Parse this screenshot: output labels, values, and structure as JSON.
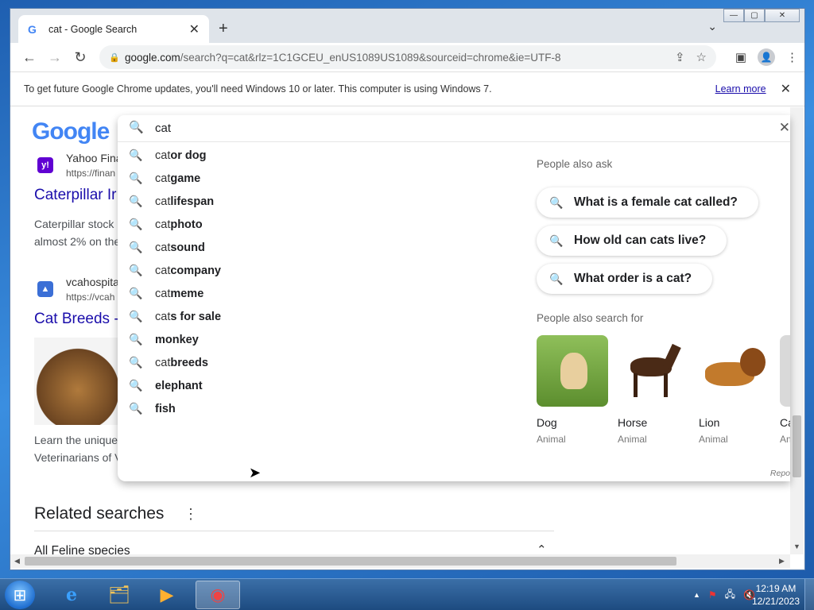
{
  "window": {
    "minimize": "—",
    "maximize": "▢",
    "close": "✕"
  },
  "tab": {
    "icon": "G",
    "title": "cat - Google Search",
    "close": "✕",
    "new_tab": "+",
    "tab_search": "⌄"
  },
  "toolbar": {
    "back": "←",
    "forward": "→",
    "reload": "↻",
    "lock": "🔒",
    "url_host": "google.com",
    "url_path": "/search?q=cat&rlz=1C1GCEU_enUS1089US1089&sourceid=chrome&ie=UTF-8",
    "share": "⇪",
    "bookmark": "☆",
    "side_panel": "▣",
    "profile": "👤",
    "menu": "⋮"
  },
  "infobar": {
    "message": "To get future Google Chrome updates, you'll need Windows 10 or later. This computer is using Windows 7.",
    "learn_more": "Learn more",
    "close": "✕"
  },
  "results": {
    "logo": "Google",
    "r1_source": "Yahoo Fina",
    "r1_url": "https://finan",
    "r1_title": "Caterpillar Ir",
    "r1_snip1": "Caterpillar stock",
    "r1_snip2": "almost 2% on the",
    "r2_source": "vcahospita",
    "r2_url": "https://vcah",
    "r2_title": "Cat Breeds -",
    "r2_snip1": "Learn the unique",
    "r2_snip2": "Veterinarians of V",
    "related_title": "Related searches",
    "related_menu": "⋮",
    "related_item": "All Feline species",
    "related_chevron": "⌃"
  },
  "search": {
    "query": "cat",
    "clear": "✕",
    "icon": "🔍",
    "suggestions": [
      {
        "plain": "cat ",
        "bold": "or dog"
      },
      {
        "plain": "cat ",
        "bold": "game"
      },
      {
        "plain": "cat ",
        "bold": "lifespan"
      },
      {
        "plain": "cat ",
        "bold": "photo"
      },
      {
        "plain": "cat ",
        "bold": "sound"
      },
      {
        "plain": "cat ",
        "bold": "company"
      },
      {
        "plain": "cat ",
        "bold": "meme"
      },
      {
        "plain": "cat",
        "bold": "s for sale"
      },
      {
        "plain": "",
        "bold": "monkey"
      },
      {
        "plain": "cat ",
        "bold": "breeds"
      },
      {
        "plain": "",
        "bold": "elephant"
      },
      {
        "plain": "",
        "bold": "fish"
      }
    ],
    "people_also_ask_title": "People also ask",
    "people_also_ask": [
      "What is a female cat called?",
      "How old can cats live?",
      "What order is a cat?"
    ],
    "people_also_search_title": "People also search for",
    "people_also_search": [
      {
        "name": "Dog",
        "sub": "Animal"
      },
      {
        "name": "Horse",
        "sub": "Animal"
      },
      {
        "name": "Lion",
        "sub": "Animal"
      },
      {
        "name": "Ca",
        "sub": "An"
      }
    ],
    "report": "Repo"
  },
  "taskbar": {
    "start": "⊞",
    "ie": "e",
    "explorer": "🗂",
    "media": "▶",
    "chrome": "◉",
    "tray_up": "▲",
    "tray_flag": "⚑",
    "tray_network": "🖧",
    "tray_volume": "🔇",
    "time": "12:19 AM",
    "date": "12/21/2023"
  }
}
